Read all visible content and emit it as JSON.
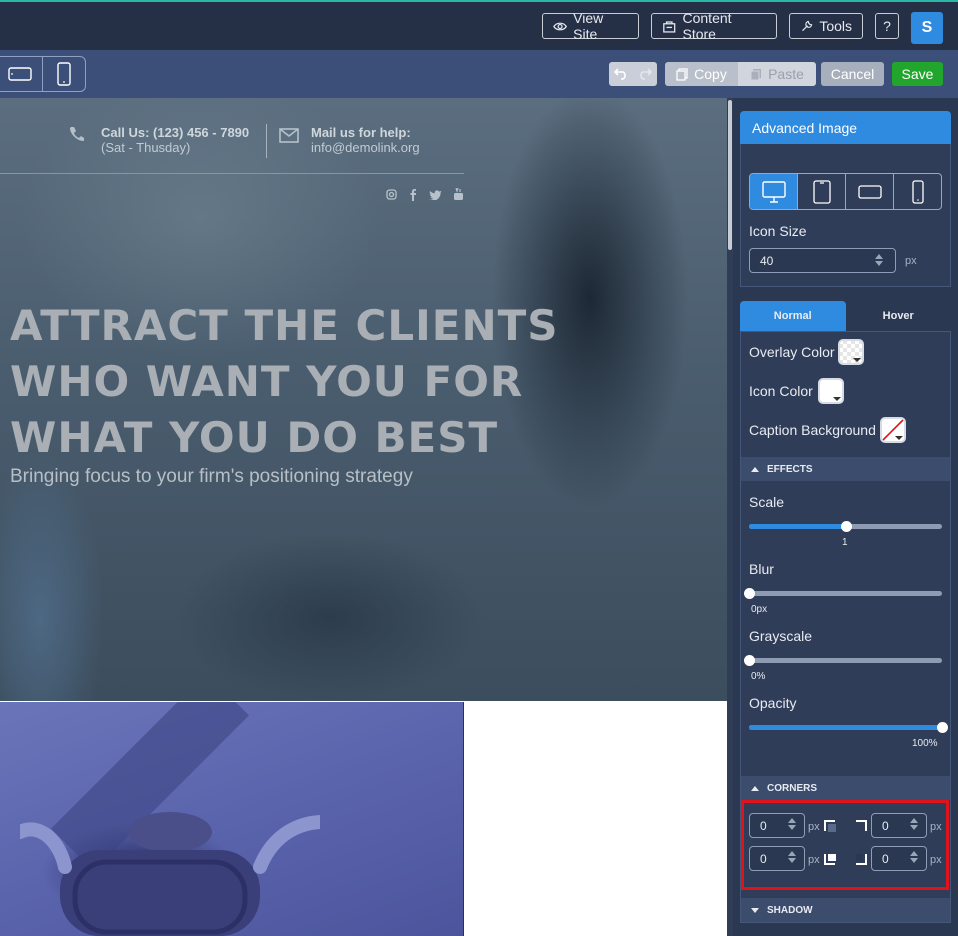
{
  "topbar": {
    "view_site": "View Site",
    "content_store": "Content Store",
    "tools": "Tools",
    "help": "?",
    "avatar": "S"
  },
  "toolbar": {
    "copy": "Copy",
    "paste": "Paste",
    "cancel": "Cancel",
    "save": "Save"
  },
  "hero": {
    "call_title": "Call Us: (123) 456 - 7890",
    "call_sub": "(Sat - Thusday)",
    "mail_title": "Mail us for help:",
    "mail_sub": "info@demolink.org",
    "headline_1": "ATTRACT THE CLIENTS",
    "headline_2": "WHO WANT YOU FOR",
    "headline_3": "WHAT YOU DO BEST",
    "subline": "Bringing focus to your firm's positioning strategy"
  },
  "panel": {
    "title": "Advanced Image",
    "icon_size_label": "Icon Size",
    "icon_size_value": "40",
    "unit_px": "px",
    "tab_normal": "Normal",
    "tab_hover": "Hover",
    "overlay_color": "Overlay Color",
    "icon_color": "Icon Color",
    "caption_background": "Caption Background",
    "effects": "EFFECTS",
    "scale_label": "Scale",
    "scale_value": "1",
    "blur_label": "Blur",
    "blur_value": "0px",
    "grayscale_label": "Grayscale",
    "grayscale_value": "0%",
    "opacity_label": "Opacity",
    "opacity_value": "100%",
    "corners": "CORNERS",
    "corner_tl": "0",
    "corner_tr": "0",
    "corner_bl": "0",
    "corner_br": "0",
    "shadow": "SHADOW"
  },
  "sliders": {
    "scale_fraction": 0.5,
    "blur_fraction": 0.0,
    "grayscale_fraction": 0.0,
    "opacity_fraction": 1.0
  },
  "colors": {
    "accent": "#2f8be0",
    "save": "#22a52c",
    "highlight": "#e0121c"
  }
}
